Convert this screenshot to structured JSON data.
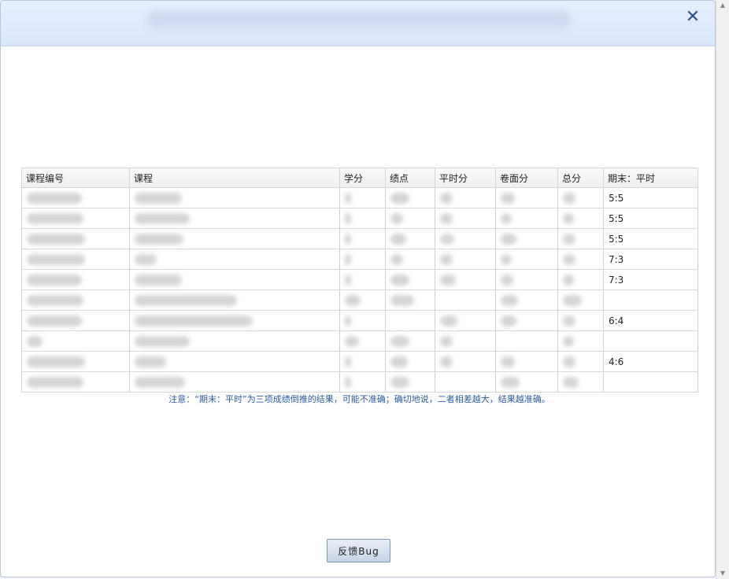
{
  "dialog": {
    "close_glyph": "✕"
  },
  "table": {
    "headers": [
      "课程编号",
      "课程",
      "学分",
      "绩点",
      "平时分",
      "卷面分",
      "总分",
      "期末：平时"
    ],
    "rows": [
      {
        "ratio": "5:5"
      },
      {
        "ratio": "5:5"
      },
      {
        "ratio": "5:5"
      },
      {
        "ratio": "7:3"
      },
      {
        "ratio": "7:3"
      },
      {
        "ratio": ""
      },
      {
        "ratio": "6:4"
      },
      {
        "ratio": ""
      },
      {
        "ratio": "4:6"
      },
      {
        "ratio": ""
      }
    ]
  },
  "note": "注意：“期末：平时”为三项成绩倒推的结果，可能不准确；确切地说，二者相差越大，结果越准确。",
  "feedback_button": "反馈Bug",
  "scrollbar": {
    "up": "▲",
    "down": "▼"
  }
}
